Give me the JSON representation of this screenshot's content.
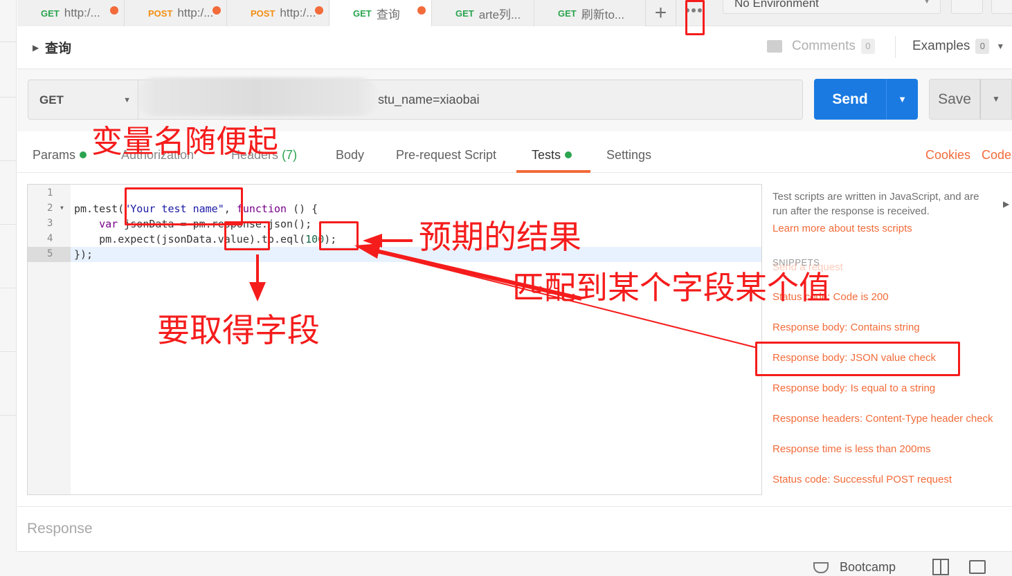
{
  "tabs": [
    {
      "method": "GET",
      "label": "http:/...",
      "dirty": true
    },
    {
      "method": "POST",
      "label": "http:/...",
      "dirty": true
    },
    {
      "method": "POST",
      "label": "http:/...",
      "dirty": true
    },
    {
      "method": "GET",
      "label": "查询",
      "dirty": true,
      "active": true
    },
    {
      "method": "GET",
      "label": "arte列...",
      "dirty": false
    },
    {
      "method": "GET",
      "label": "刷新to...",
      "dirty": false
    }
  ],
  "add_tab_icon": "plus-icon",
  "more_tabs_icon": "more-horizontal-icon",
  "environment": {
    "selected": "No Environment"
  },
  "request": {
    "name": "查询",
    "comments_label": "Comments",
    "comments_count": "0",
    "examples_label": "Examples",
    "examples_count": "0",
    "method": "GET",
    "url_visible": "stu_name=xiaobai",
    "send_label": "Send",
    "save_label": "Save"
  },
  "subtabs": {
    "params": "Params",
    "authorization": "Authorization",
    "headers": "Headers",
    "headers_count": "(7)",
    "body": "Body",
    "prerequest": "Pre-request Script",
    "tests": "Tests",
    "settings": "Settings",
    "cookies": "Cookies",
    "code": "Code"
  },
  "editor": {
    "line_numbers": [
      "1",
      "2",
      "3",
      "4",
      "5"
    ]
  },
  "snippets": {
    "description": "Test scripts are written in JavaScript, and are run after the response is received.",
    "learn_more": "Learn more about tests scripts",
    "title": "SNIPPETS",
    "items": [
      "Send a request",
      "Status code: Code is 200",
      "Response body: Contains string",
      "Response body: JSON value check",
      "Response body: Is equal to a string",
      "Response headers: Content-Type header check",
      "Response time is less than 200ms",
      "Status code: Successful POST request"
    ]
  },
  "response": {
    "label": "Response"
  },
  "statusbar": {
    "bootcamp": "Bootcamp"
  },
  "annotations": {
    "variable_name": "变量名随便起",
    "expected_result": "预期的结果",
    "field_to_get": "要取得字段",
    "match_field_value": "匹配到某个字段某个值"
  },
  "colors": {
    "accent": "#f26b3a",
    "send": "#1a7ae2",
    "get": "#2ba44f",
    "post": "#f28e12",
    "annotation": "#f51c1c"
  }
}
